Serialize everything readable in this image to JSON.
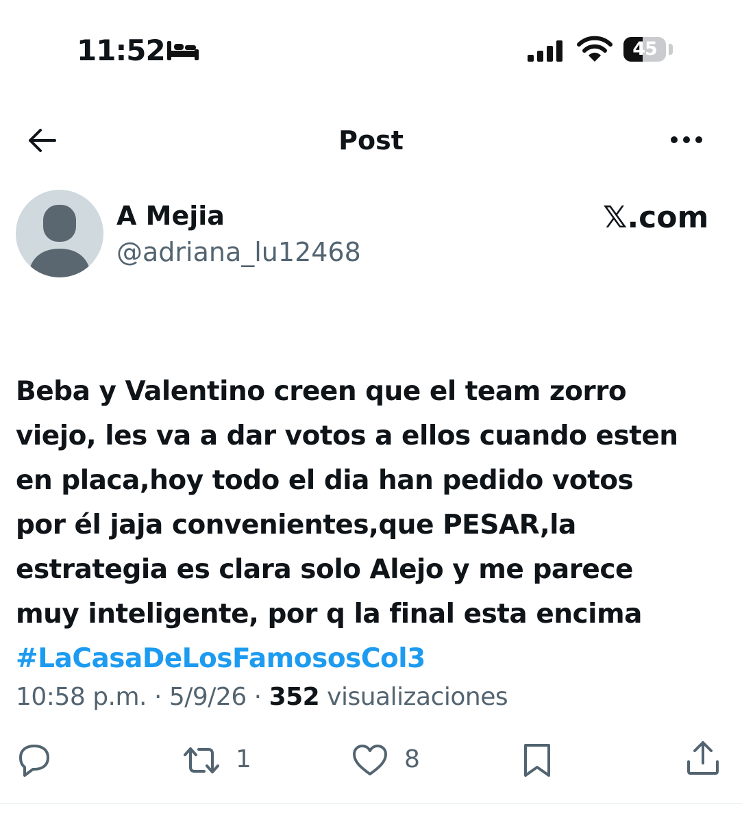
{
  "status_bar": {
    "time": "11:52",
    "battery_level": "45",
    "battery_fraction": 0.45,
    "icons": [
      "bed-icon",
      "signal-icon",
      "wifi-icon",
      "battery-icon"
    ]
  },
  "header": {
    "title": "Post",
    "icons": [
      "back-arrow-icon",
      "more-options-icon"
    ]
  },
  "author": {
    "name": "A Mejia",
    "handle": "@adriana_lu12468",
    "site_label": "𝕏.com"
  },
  "post": {
    "text": "Beba y Valentino creen que el team zorro\nviejo, les va a dar votos a ellos cuando esten\nen placa,hoy todo el dia han pedido votos\npor él jaja convenientes,que PESAR,la\nestrategia es clara solo Alejo y me parece\nmuy inteligente, por q la final esta encima",
    "hashtag": "#LaCasaDeLosFamososCol3",
    "time": "10:58 p.m.",
    "separator": " · ",
    "date": "5/9/26",
    "views_count": "352",
    "views_label": " visualizaciones"
  },
  "actions": {
    "retweets": "1",
    "likes": "8"
  },
  "colors": {
    "text": "#0f1419",
    "secondary": "#536471",
    "link": "#1d9bf0",
    "avatar_bg": "#cfd9de"
  }
}
